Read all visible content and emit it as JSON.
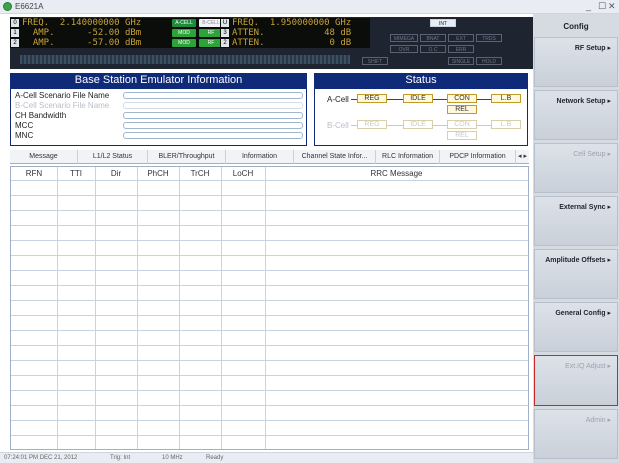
{
  "window": {
    "title": "E6621A",
    "controls": [
      "_",
      "☐",
      "✕"
    ]
  },
  "display": {
    "a_cell": {
      "ch": [
        "0",
        "1",
        "2"
      ],
      "lines": [
        "FREQ.  2.140000000 GHz",
        "  AMP.      -52.00 dBm",
        "  AMP.      -57.00 dBm"
      ],
      "pills": [
        "A-CELL",
        "B-CELL",
        "MOD",
        "RF",
        "MOD",
        "RF"
      ]
    },
    "b_cell": {
      "ch": [
        "U",
        "3",
        "2"
      ],
      "lines": [
        "FREQ.  1.950000000 GHz",
        "ATTEN.           48 dB",
        "ATTEN.            0 dB"
      ]
    },
    "indicators": [
      "INT",
      "MIMEGA",
      "BNAT",
      "EXT",
      "TRDS",
      "OVR",
      "O.C",
      "ERR",
      "SHIFT",
      "SINGLE",
      "HOLD"
    ]
  },
  "info": {
    "header": "Base Station Emulator Information",
    "labels": [
      "A-Cell Scenario File Name",
      "B-Cell Scenario File Name",
      "CH Bandwidth",
      "MCC",
      "MNC"
    ]
  },
  "status": {
    "header": "Status",
    "a_cell": "A-Cell",
    "b_cell": "B-Cell",
    "states": [
      "REG",
      "IDLE",
      "CON",
      "L.B",
      "REL"
    ]
  },
  "tabs": [
    "Message",
    "L1/L2 Status",
    "BLER/Throughput",
    "Information",
    "Channel State Infor...",
    "RLC Information",
    "PDCP Information",
    "◂ ▸"
  ],
  "table": {
    "columns": [
      "RFN",
      "TTI",
      "Dir",
      "PhCH",
      "TrCH",
      "LoCH",
      "RRC Message"
    ]
  },
  "right_panel": {
    "title": "Config",
    "buttons": [
      "RF Setup ▸",
      "Network Setup ▸",
      "Cell Setup ▸",
      "External Sync ▸",
      "Amplitude Offsets ▸",
      "General Config ▸",
      "Ext.IQ Adjust ▸",
      "Admin ▸"
    ]
  },
  "status_bar": {
    "time": "07:24:01 PM DEC 21, 2012",
    "trig": "Trig: Int",
    "ref": "10 MHz",
    "state": "Ready"
  }
}
